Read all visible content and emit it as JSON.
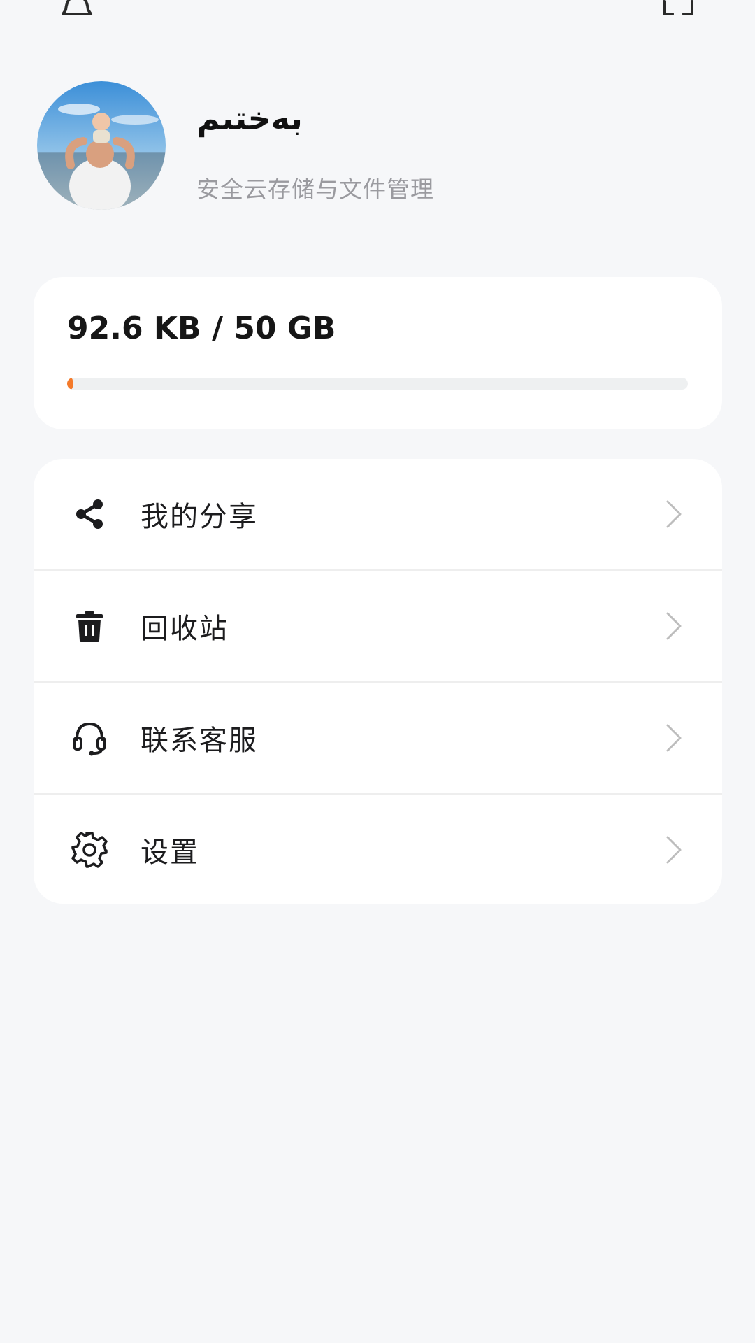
{
  "header": {
    "left_icon": "bell-icon",
    "right_icon": "scan-icon"
  },
  "profile": {
    "avatar_icon": "avatar-photo",
    "name": "بەختىم",
    "subtitle": "安全云存储与文件管理"
  },
  "storage": {
    "usage_text": "92.6 KB / 50 GB",
    "used_fraction": 1.8e-06,
    "accent_color": "#f47a2a"
  },
  "menu": {
    "items": [
      {
        "icon": "share-icon",
        "label": "我的分享"
      },
      {
        "icon": "trash-icon",
        "label": "回收站"
      },
      {
        "icon": "headset-icon",
        "label": "联系客服"
      },
      {
        "icon": "gear-icon",
        "label": "设置"
      }
    ]
  }
}
